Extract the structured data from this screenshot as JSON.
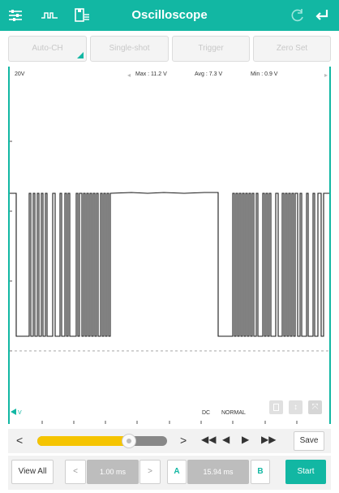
{
  "header": {
    "title": "Oscilloscope",
    "left_icons": [
      "settings-sliders-icon",
      "signal-waveform-icon",
      "save-file-icon"
    ],
    "right_icons": [
      "refresh-icon",
      "back-arrow-icon"
    ]
  },
  "toolbar": {
    "buttons": [
      "Auto-CH",
      "Single-shot",
      "Trigger",
      "Zero Set"
    ]
  },
  "scope": {
    "voltage_scale": "20V",
    "max": "Max : 11.2 V",
    "avg": "Avg : 7.3 V",
    "min": "Min : 0.9 V",
    "coupling": "DC",
    "mode": "NORMAL",
    "bottom_icons": [
      "channel-toggle-icon",
      "vertical-move-icon",
      "compress-icon"
    ],
    "colors": {
      "accent": "#12b7a3",
      "waveform": "#1a1a1a",
      "slider": "#f5c400"
    }
  },
  "slider_row": {
    "slider_position": 0.73,
    "save_label": "Save"
  },
  "bottom_row": {
    "view_all_label": "View All",
    "time_div": "1.00 ms",
    "cursor_a_label": "A",
    "cursor_value": "15.94 ms",
    "cursor_b_label": "B",
    "start_label": "Start"
  }
}
